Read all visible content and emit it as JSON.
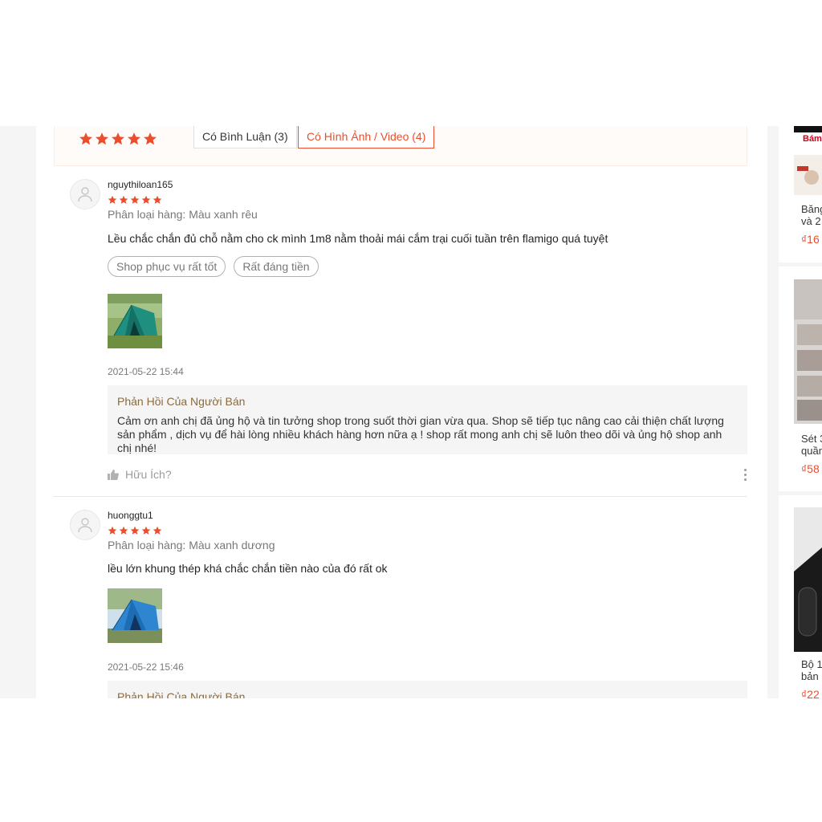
{
  "rating_overview": {
    "stars": 5,
    "filters": [
      {
        "label": "Có Bình Luận (3)",
        "active": false
      },
      {
        "label": "Có Hình Ảnh / Video (4)",
        "active": true
      }
    ]
  },
  "reviews": [
    {
      "author": "nguythiloan165",
      "rating": 5,
      "variation": "Phân loại hàng: Màu xanh rêu",
      "comment": "Lều chắc chắn đủ chỗ nằm cho ck mình 1m8 nằm thoải mái cắm trại cuối tuần trên flamigo quá tuyệt",
      "tags": [
        "Shop phục vụ rất tốt",
        "Rất đáng tiền"
      ],
      "photo": "green-tent-photo",
      "date": "2021-05-22 15:44",
      "reply_title": "Phản Hồi Của Người Bán",
      "reply_text": "Cảm ơn anh chị đã ủng hộ và tin tưởng shop trong suốt thời gian vừa qua. Shop sẽ tiếp tục nâng cao cải thiện chất lượng sản phẩm , dịch vụ để hài lòng nhiều khách hàng hơn nữa ạ ! shop  rất mong anh chị sẽ luôn theo dõi và ủng hộ shop anh chị nhé!",
      "helpful_label": "Hữu Ích?"
    },
    {
      "author": "huonggtu1",
      "rating": 5,
      "variation": "Phân loại hàng: Màu xanh dương",
      "comment": "lều lớn khung thép khá chắc chắn tiền nào của đó rất ok",
      "photo": "blue-tent-photo",
      "date": "2021-05-22 15:46",
      "reply_title": "Phản Hồi Của Người Bán"
    }
  ],
  "sidebar_products": [
    {
      "badge": "Bám",
      "name_line1": "Băng",
      "name_line2": "và 2",
      "price": "₫16"
    },
    {
      "name_line1": "Sét 3",
      "name_line2": "quần",
      "price": "₫58"
    },
    {
      "name_line1": "Bộ 1",
      "name_line2": "bản",
      "price": "₫22"
    }
  ],
  "colors": {
    "accent": "#ee4d2d",
    "reply_title": "#8b6b3d"
  }
}
